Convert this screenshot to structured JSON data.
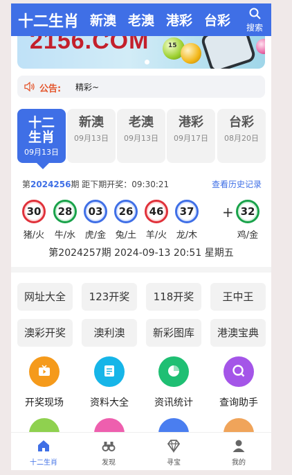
{
  "header": {
    "tabs": [
      {
        "label": "十二生肖",
        "active": true
      },
      {
        "label": "新澳"
      },
      {
        "label": "老澳"
      },
      {
        "label": "港彩"
      },
      {
        "label": "台彩"
      }
    ],
    "search_label": "搜索",
    "search_icon": "search-icon"
  },
  "banner": {
    "text": "2156.COM",
    "ball_number": "15"
  },
  "notice": {
    "icon": "speaker-icon",
    "label": "公告:",
    "text": "精彩~"
  },
  "lottery_tabs": [
    {
      "name": "十二生肖",
      "date": "09月13日",
      "active": true
    },
    {
      "name": "新澳",
      "date": "09月13日"
    },
    {
      "name": "老澳",
      "date": "09月13日"
    },
    {
      "name": "港彩",
      "date": "09月17日"
    },
    {
      "name": "台彩",
      "date": "08月20日"
    }
  ],
  "draw": {
    "prefix": "第",
    "issue": "2024256",
    "mid": "期 距下期开奖：09:30:21",
    "history_link": "查看历史记录",
    "balls": [
      {
        "number": "30",
        "zodiac": "猪/火",
        "color": "red"
      },
      {
        "number": "28",
        "zodiac": "牛/水",
        "color": "green"
      },
      {
        "number": "03",
        "zodiac": "虎/金",
        "color": "blue"
      },
      {
        "number": "26",
        "zodiac": "兔/土",
        "color": "blue"
      },
      {
        "number": "46",
        "zodiac": "羊/火",
        "color": "red"
      },
      {
        "number": "37",
        "zodiac": "龙/木",
        "color": "blue"
      }
    ],
    "plus": "+",
    "special": {
      "number": "32",
      "zodiac": "鸡/金",
      "color": "green"
    },
    "next_draw": "第2024257期 2024-09-13 20:51 星期五"
  },
  "link_buttons": [
    "网址大全",
    "123开奖",
    "118开奖",
    "王中王",
    "澳彩开奖",
    "澳利澳",
    "新彩图库",
    "港澳宝典"
  ],
  "feature_grid": [
    {
      "label": "开奖现场",
      "icon": "tv-icon",
      "color": "#f59a1b"
    },
    {
      "label": "资料大全",
      "icon": "document-icon",
      "color": "#16b5e8"
    },
    {
      "label": "资讯统计",
      "icon": "pie-chart-icon",
      "color": "#1fbf73"
    },
    {
      "label": "查询助手",
      "icon": "query-icon",
      "color": "#a455e8"
    }
  ],
  "bottom_nav": [
    {
      "label": "十二生肖",
      "icon": "home-icon",
      "active": true
    },
    {
      "label": "发现",
      "icon": "binoculars-icon"
    },
    {
      "label": "寻宝",
      "icon": "diamond-icon"
    },
    {
      "label": "我的",
      "icon": "user-icon"
    }
  ],
  "colors": {
    "primary": "#3f6fe6",
    "notice_label": "#e4572e",
    "ball_red": "#e0313a",
    "ball_green": "#19a24a",
    "ball_blue": "#3f6fe6"
  }
}
